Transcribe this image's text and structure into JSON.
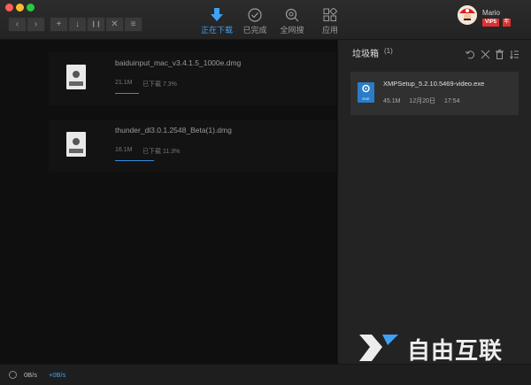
{
  "toolbar": {
    "buttons": [
      {
        "name": "back-button",
        "glyph": "‹"
      },
      {
        "name": "forward-button",
        "glyph": "›"
      },
      {
        "name": "new-task-button",
        "glyph": "+"
      },
      {
        "name": "start-button",
        "glyph": "↓"
      },
      {
        "name": "pause-button",
        "glyph": "❙❙"
      },
      {
        "name": "delete-button",
        "glyph": "✕"
      },
      {
        "name": "sort-button",
        "glyph": "≡"
      }
    ]
  },
  "nav": {
    "tabs": [
      {
        "label": "正在下载",
        "icon": "download-arrow-icon",
        "active": true
      },
      {
        "label": "已完成",
        "icon": "check-circle-icon",
        "active": false
      },
      {
        "label": "全网搜",
        "icon": "search-eye-icon",
        "active": false
      },
      {
        "label": "应用",
        "icon": "apps-grid-icon",
        "active": false
      }
    ]
  },
  "user": {
    "name": "Mario",
    "vip": "VIP5",
    "year": "年"
  },
  "downloads": [
    {
      "file": "baiduinput_mac_v3.4.1.5_1000e.dmg",
      "size": "21.1M",
      "status": "已下载 7.3%",
      "progress": 0.073
    },
    {
      "file": "thunder_dl3.0.1.2548_Beta(1).dmg",
      "size": "16.1M",
      "status": "已下载 11.3%",
      "progress": 0.113
    }
  ],
  "trash": {
    "title": "垃圾箱",
    "count": "(1)",
    "items": [
      {
        "file": "XMPSetup_5.2.10.5469-video.exe",
        "size": "45.1M",
        "date": "12月20日",
        "time": "17:54",
        "icon_label": "EXE"
      }
    ]
  },
  "status": {
    "down_speed": "0B/s",
    "up_speed": "+0B/s"
  },
  "watermark": {
    "text": "自由互联"
  },
  "colors": {
    "accent": "#3fa1f5",
    "progress": "#2f8fe0",
    "vip_red": "#e03030"
  }
}
